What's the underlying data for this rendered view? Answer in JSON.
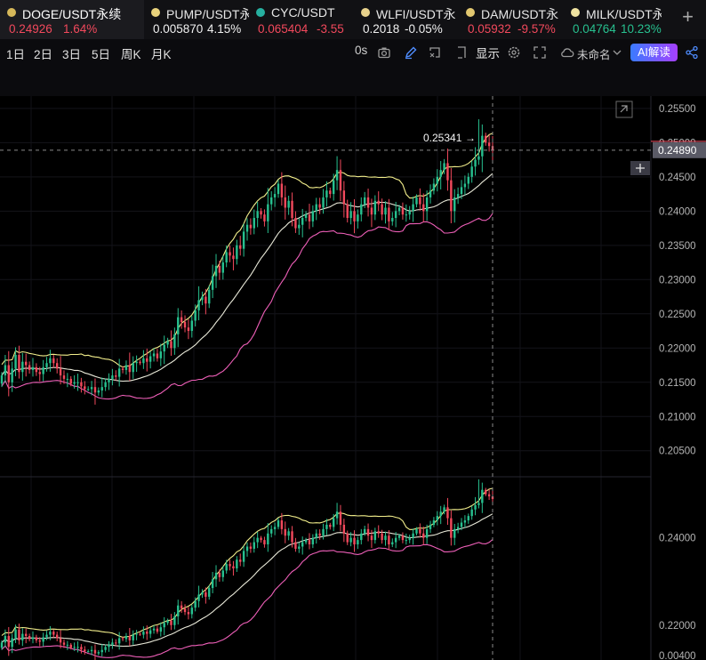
{
  "tabs": [
    {
      "symbol": "DOGE/USDT永续",
      "price": "0.24926",
      "change": "1.64%",
      "price_color": "red",
      "change_color": "red",
      "coin_color": "#d6b85a",
      "active": true
    },
    {
      "symbol": "PUMP/USDT永",
      "price": "0.005870",
      "change": "4.15%",
      "price_color": "white",
      "change_color": "white",
      "coin_color": "#e9d27c",
      "active": false
    },
    {
      "symbol": "CYC/USDT",
      "price": "0.065404",
      "change": "-3.55",
      "price_color": "red",
      "change_color": "red",
      "coin_color": "#26b0a0",
      "active": false
    },
    {
      "symbol": "WLFI/USDT永",
      "price": "0.2018",
      "change": "-0.05%",
      "price_color": "white",
      "change_color": "white",
      "coin_color": "#e8d28c",
      "active": false
    },
    {
      "symbol": "DAM/USDT永",
      "price": "0.05932",
      "change": "-9.57%",
      "price_color": "red",
      "change_color": "red",
      "coin_color": "#e2c870",
      "active": false
    },
    {
      "symbol": "MILK/USDT永",
      "price": "0.04764",
      "change": "10.23%",
      "price_color": "green",
      "change_color": "green",
      "coin_color": "#efe2a0",
      "active": false
    }
  ],
  "tab_add_label": "+",
  "toolbar": {
    "intervals": [
      "1日",
      "2日",
      "3日",
      "5日",
      "周K",
      "月K"
    ],
    "countdown": "0s",
    "display_label": "显示",
    "layout_name": "未命名",
    "ai_button_label": "AI解读"
  },
  "colors": {
    "up": "#27c08f",
    "down": "#f2495c",
    "upper_band": "#f3ef8c",
    "middle_band": "#e8e8d8",
    "lower_band": "#ee5fb8"
  },
  "icons": [
    "camera-icon",
    "pencil-icon",
    "select-icon",
    "gear-icon",
    "fullscreen-icon",
    "cloud-icon",
    "share-icon",
    "expand-icon",
    "crosshair-plus-icon"
  ],
  "chart_data": {
    "type": "candlestick",
    "main_axis_ticks": [
      "0.25500",
      "0.25000",
      "0.24500",
      "0.24000",
      "0.23500",
      "0.23000",
      "0.22500",
      "0.22000",
      "0.21500",
      "0.21000",
      "0.20500"
    ],
    "main_ylim": [
      0.2012,
      0.2568
    ],
    "current_price_label": "0.24890",
    "current_price": 0.2489,
    "high_label": "0.25341",
    "high_arrow": "→",
    "sub_axis_ticks": [
      "0.24000",
      "0.22000",
      "0.00400"
    ],
    "sub_ylim": [
      0.212,
      0.254
    ],
    "series": {
      "close": [
        0.216,
        0.2175,
        0.215,
        0.217,
        0.219,
        0.2165,
        0.218,
        0.2175,
        0.2168,
        0.2172,
        0.2165,
        0.2162,
        0.2172,
        0.2178,
        0.2185,
        0.2178,
        0.217,
        0.216,
        0.2155,
        0.2155,
        0.2148,
        0.215,
        0.215,
        0.2144,
        0.214,
        0.214,
        0.2143,
        0.2135,
        0.2138,
        0.2143,
        0.215,
        0.2155,
        0.216,
        0.2158,
        0.217,
        0.2168,
        0.2175,
        0.2165,
        0.2178,
        0.218,
        0.2178,
        0.2185,
        0.218,
        0.2188,
        0.2192,
        0.2185,
        0.2195,
        0.2205,
        0.221,
        0.22,
        0.222,
        0.2245,
        0.2238,
        0.223,
        0.2225,
        0.224,
        0.2255,
        0.227,
        0.2275,
        0.2265,
        0.2285,
        0.2305,
        0.232,
        0.231,
        0.2325,
        0.234,
        0.2335,
        0.233,
        0.235,
        0.2345,
        0.237,
        0.238,
        0.2375,
        0.239,
        0.24,
        0.2395,
        0.2385,
        0.241,
        0.242,
        0.2425,
        0.244,
        0.242,
        0.2405,
        0.2415,
        0.239,
        0.2375,
        0.238,
        0.239,
        0.2395,
        0.2385,
        0.24,
        0.241,
        0.2405,
        0.242,
        0.243,
        0.2425,
        0.2445,
        0.246,
        0.243,
        0.241,
        0.239,
        0.24,
        0.2385,
        0.2395,
        0.241,
        0.242,
        0.2405,
        0.2395,
        0.2415,
        0.241,
        0.2395,
        0.2405,
        0.2385,
        0.239,
        0.24,
        0.2405,
        0.2395,
        0.2395,
        0.24,
        0.241,
        0.242,
        0.241,
        0.24,
        0.242,
        0.243,
        0.244,
        0.245,
        0.246,
        0.247,
        0.2445,
        0.24,
        0.242,
        0.2425,
        0.2435,
        0.244,
        0.245,
        0.2465,
        0.2475,
        0.248,
        0.251,
        0.25,
        0.2495,
        0.2489
      ]
    },
    "bands": "bollinger(20,2)"
  }
}
